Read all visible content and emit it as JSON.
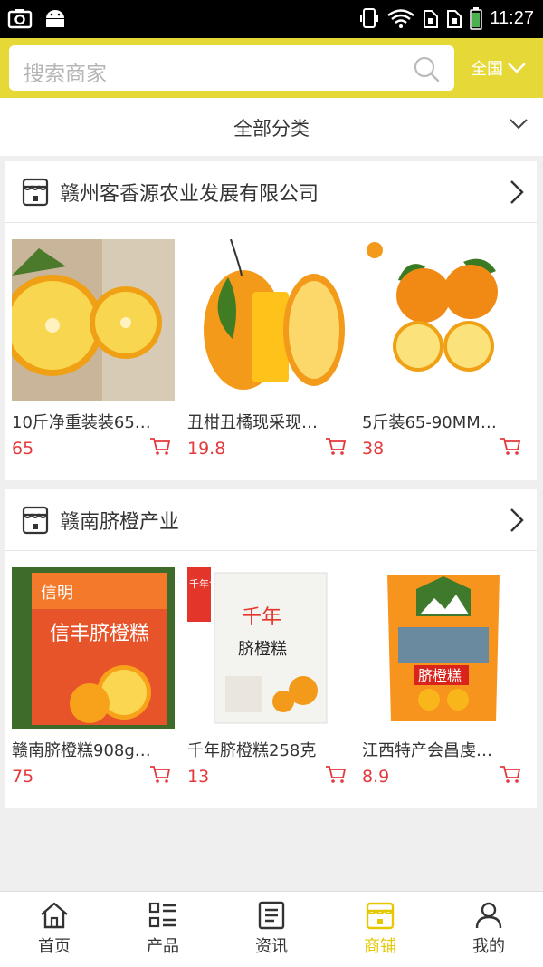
{
  "status_bar": {
    "time": "11:27",
    "icons": [
      "screenshot-icon",
      "android-icon",
      "vibrate-icon",
      "wifi-icon",
      "sim1-icon",
      "sim2-icon",
      "battery-icon"
    ]
  },
  "search": {
    "placeholder": "搜索商家",
    "region": "全国"
  },
  "category": {
    "label": "全部分类"
  },
  "shops": [
    {
      "name": "赣州客香源农业发展有限公司",
      "products": [
        {
          "name": "10斤净重装装65…",
          "price": "65"
        },
        {
          "name": "丑柑丑橘现采现…",
          "price": "19.8"
        },
        {
          "name": "5斤装65-90MM…",
          "price": "38"
        }
      ]
    },
    {
      "name": "赣南脐橙产业",
      "products": [
        {
          "name": "赣南脐橙糕908g…",
          "price": "75"
        },
        {
          "name": "千年脐橙糕258克",
          "price": "13"
        },
        {
          "name": "江西特产会昌虔…",
          "price": "8.9"
        }
      ]
    }
  ],
  "image_texts": {
    "p4_brand": "信明",
    "p4_title": "信丰脐橙糕",
    "p5_brand": "千年食品",
    "p5_logo": "千年",
    "p5_title": "脐橙糕",
    "p6_title": "脐橙糕"
  },
  "nav": [
    {
      "label": "首页",
      "icon": "home-icon"
    },
    {
      "label": "产品",
      "icon": "grid-list-icon"
    },
    {
      "label": "资讯",
      "icon": "news-icon"
    },
    {
      "label": "商铺",
      "icon": "store-icon",
      "active": true
    },
    {
      "label": "我的",
      "icon": "user-icon"
    }
  ],
  "colors": {
    "accent": "#e6d836",
    "price": "#e4393c",
    "active_nav": "#e6c800"
  }
}
